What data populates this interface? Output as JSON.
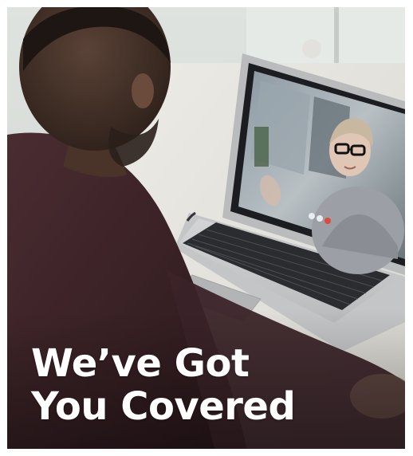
{
  "headline": {
    "line1": "We’ve Got",
    "line2": "You Covered"
  },
  "colors": {
    "background_wall": "#d8dcd8",
    "desk": "#e9e7e1",
    "shirt": "#3a2226",
    "laptop_body": "#c9cacc",
    "screen_bezel": "#1b1d20",
    "text": "#ffffff"
  }
}
